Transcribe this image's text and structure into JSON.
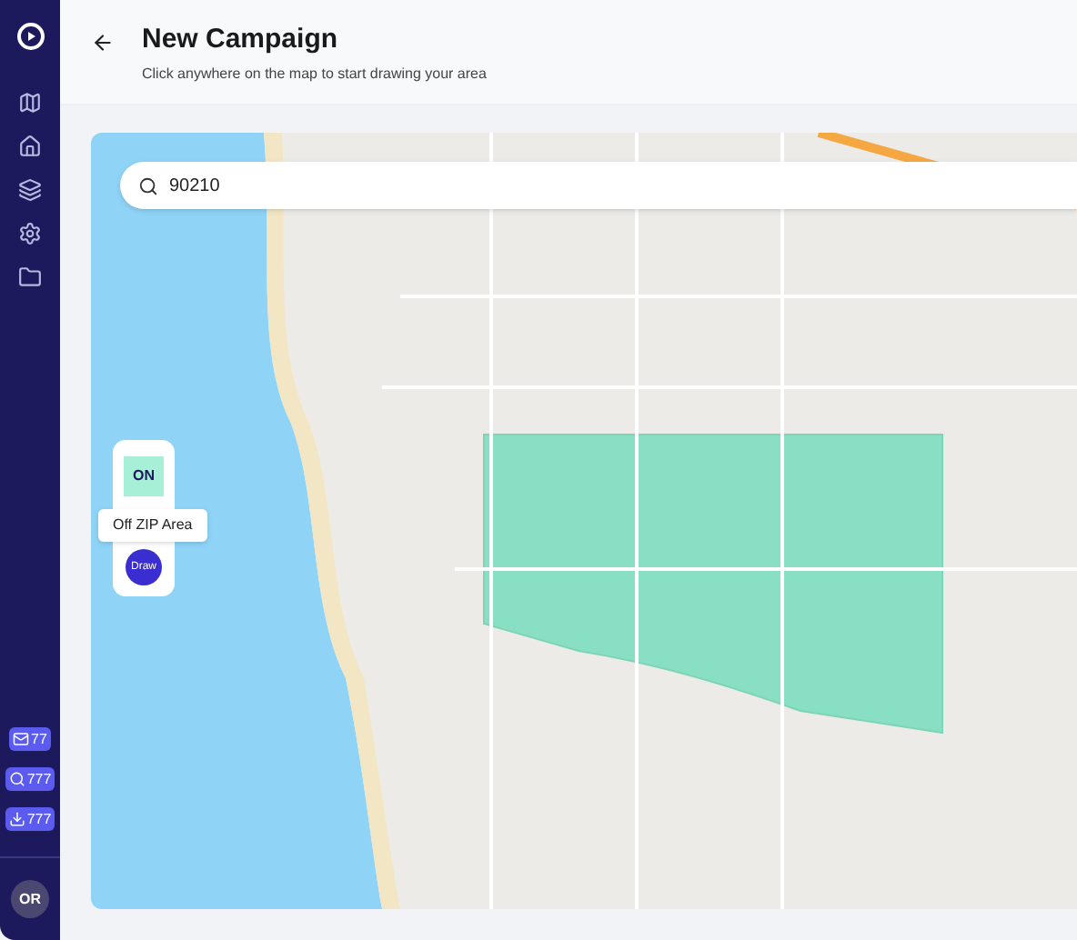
{
  "sidebar": {
    "badges": [
      {
        "kind": "mail",
        "count": "77"
      },
      {
        "kind": "search",
        "count": "777"
      },
      {
        "kind": "download",
        "count": "777"
      }
    ],
    "avatar": "OR"
  },
  "header": {
    "title": "New Campaign",
    "subtitle": "Click anywhere on the map to start drawing your area"
  },
  "map": {
    "search": {
      "value": "90210"
    },
    "zip_toggle": {
      "label": "ON",
      "on": true
    },
    "tooltip": "Off ZIP Area",
    "draw_button": "Draw"
  }
}
